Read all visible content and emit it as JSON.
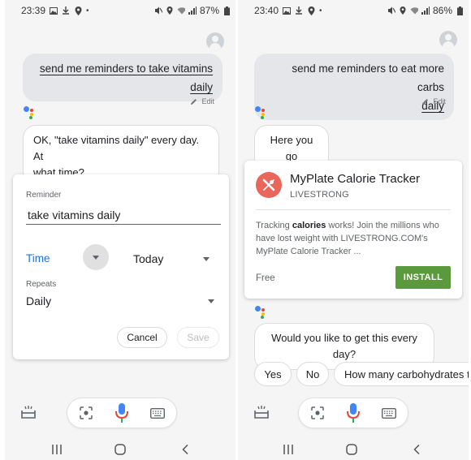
{
  "left_screen": {
    "status": {
      "time": "23:39",
      "battery": "87%"
    },
    "user_query": {
      "line1": "send me reminders to take vitamins",
      "line2": "daily"
    },
    "edit_label": "Edit",
    "assistant_reply": {
      "line1": "OK, \"take vitamins daily\" every day. At",
      "line2": "what time?"
    },
    "reminder_card": {
      "reminder_label": "Reminder",
      "reminder_value": "take vitamins daily",
      "time_label": "Time",
      "date_value": "Today",
      "repeats_label": "Repeats",
      "repeats_value": "Daily",
      "cancel_label": "Cancel",
      "save_label": "Save"
    }
  },
  "right_screen": {
    "status": {
      "time": "23:40",
      "battery": "86%"
    },
    "user_query": {
      "line1": "send me reminders to eat more carbs",
      "line2": "daily"
    },
    "edit_label": "Edit",
    "assistant_reply": "Here you go",
    "app_card": {
      "app_name": "MyPlate Calorie Tracker",
      "publisher": "LIVESTRONG",
      "desc_prefix": "Tracking ",
      "desc_bold": "calories",
      "desc_suffix": " works! Join the millions who",
      "desc_line2": "have lost weight with LIVESTRONG.COM's",
      "desc_line3": "MyPlate Calorie Tracker ...",
      "price": "Free",
      "install_label": "INSTALL",
      "accent": "#5a9a3c",
      "icon_color": "#e8665a"
    },
    "followup_question": "Would you like to get this every day?",
    "suggestions": [
      "Yes",
      "No",
      "How many carbohydrates to"
    ]
  },
  "colors": {
    "assistant_blue": "#1a73e8",
    "mic_red": "#ea4335",
    "mic_blue": "#4285f4"
  }
}
